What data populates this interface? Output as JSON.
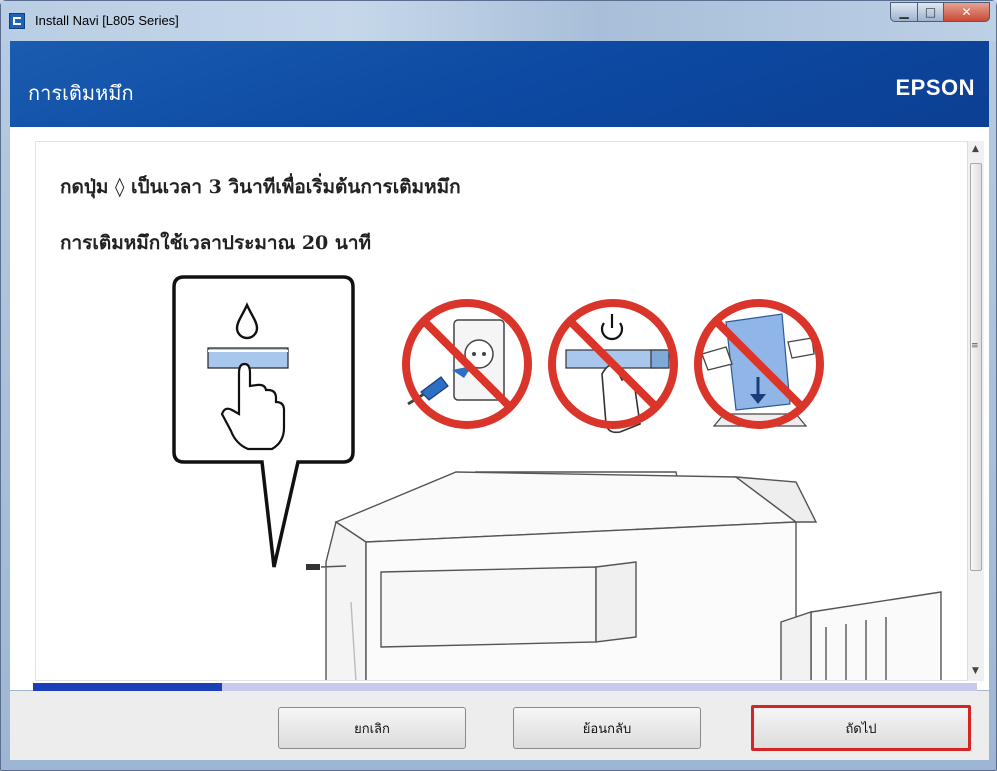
{
  "window": {
    "title": "Install Navi [L805 Series]"
  },
  "header": {
    "title": "การเติมหมึก",
    "brand": "EPSON"
  },
  "content": {
    "line1": "กดปุ่ม ◊ เป็นเวลา 3 วินาทีเพื่อเริ่มต้นการเติมหมึก",
    "line2": "การเติมหมึกใช้เวลาประมาณ 20 นาที"
  },
  "illustration": {
    "callout_icon": "ink-drop-icon",
    "prohibited_icons": [
      "unplug-prohibited-icon",
      "power-button-prohibited-icon",
      "load-paper-prohibited-icon"
    ]
  },
  "progress": {
    "value_percent": 20
  },
  "buttons": {
    "cancel": "ยกเลิก",
    "back": "ย้อนกลับ",
    "next": "ถัดไป"
  },
  "colors": {
    "header": "#0d4aa3",
    "progress_fill": "#1a3fb8",
    "highlight": "#d62424",
    "prohibit": "#d9352a"
  }
}
